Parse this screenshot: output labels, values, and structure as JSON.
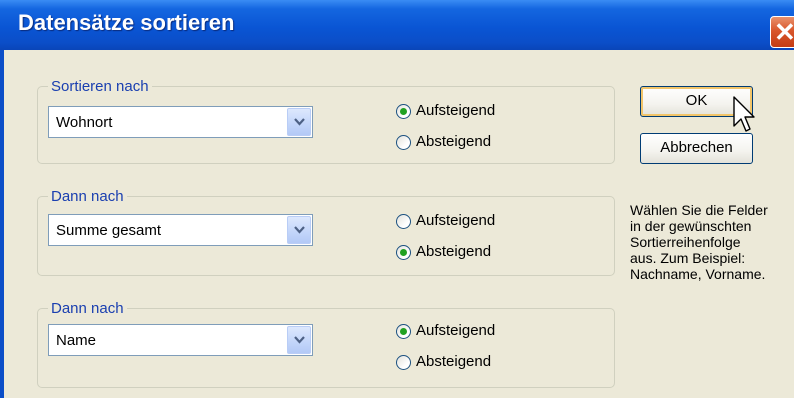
{
  "window": {
    "title": "Datensätze sortieren",
    "close_glyph": "✕"
  },
  "groups": [
    {
      "legend": "Sortieren nach",
      "field": "Wohnort",
      "options": [
        "Aufsteigend",
        "Absteigend"
      ],
      "selected": "Aufsteigend"
    },
    {
      "legend": "Dann nach",
      "field": "Summe gesamt",
      "options": [
        "Aufsteigend",
        "Absteigend"
      ],
      "selected": "Absteigend"
    },
    {
      "legend": "Dann nach",
      "field": "Name",
      "options": [
        "Aufsteigend",
        "Absteigend"
      ],
      "selected": "Aufsteigend"
    }
  ],
  "buttons": {
    "ok": "OK",
    "cancel": "Abbrechen"
  },
  "help_lines": [
    "Wählen Sie die Felder",
    "in der gewünschten",
    "Sortierreihenfolge",
    "aus. Zum Beispiel:",
    "Nachname, Vorname."
  ],
  "colors": {
    "titlebar": "#0a55d4",
    "dialog_bg": "#ece9d8",
    "group_label": "#1a3fb0",
    "radio_dot": "#21a121"
  }
}
